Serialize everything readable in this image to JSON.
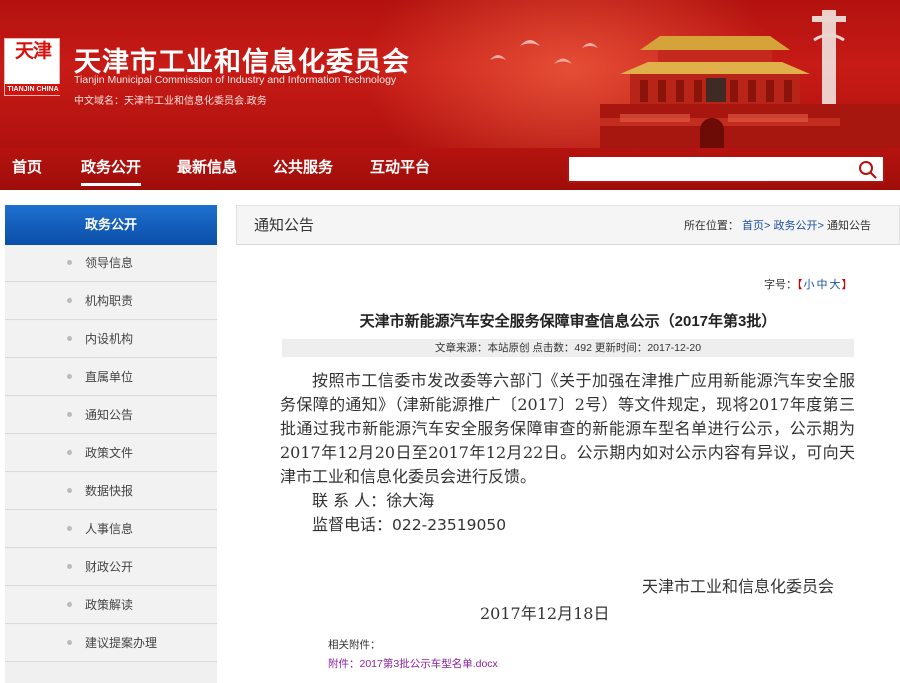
{
  "header": {
    "logo_glyph": "天津",
    "logo_tag": "TIANJIN CHINA",
    "site_title": "天津市工业和信息化委员会",
    "site_subtitle": "Tianjin Municipal Commission  of Industry and Information Technology",
    "domain_line": "中文域名：天津市工业和信息化委员会.政务"
  },
  "nav": {
    "items": [
      {
        "label": "首页"
      },
      {
        "label": "政务公开"
      },
      {
        "label": "最新信息"
      },
      {
        "label": "公共服务"
      },
      {
        "label": "互动平台"
      }
    ],
    "active_index": 1,
    "search": {
      "value": "",
      "placeholder": ""
    }
  },
  "sidebar": {
    "heading": "政务公开",
    "items": [
      {
        "label": "领导信息"
      },
      {
        "label": "机构职责"
      },
      {
        "label": "内设机构"
      },
      {
        "label": "直属单位"
      },
      {
        "label": "通知公告"
      },
      {
        "label": "政策文件"
      },
      {
        "label": "数据快报"
      },
      {
        "label": "人事信息"
      },
      {
        "label": "财政公开"
      },
      {
        "label": "政策解读"
      },
      {
        "label": "建议提案办理"
      }
    ]
  },
  "main": {
    "section_title": "通知公告",
    "breadcrumb": {
      "prefix": "所在位置：",
      "home": "首页>",
      "section": "政务公开>",
      "current": "通知公告"
    },
    "font_size": {
      "label": "字号：",
      "open": "【",
      "small": "小",
      "medium": "中",
      "large": "大",
      "close": "】"
    },
    "article": {
      "title": "天津市新能源汽车安全服务保障审查信息公示（2017年第3批）",
      "meta": "文章来源：本站原创 点击数：492 更新时间：2017-12-20",
      "paragraph": "按照市工信委市发改委等六部门《关于加强在津推广应用新能源汽车安全服务保障的通知》（津新能源推广〔2017〕2号）等文件规定，现将2017年度第三批通过我市新能源汽车安全服务保障审查的新能源车型名单进行公示，公示期为2017年12月20日至2017年12月22日。公示期内如对公示内容有异议，可向天津市工业和信息化委员会进行反馈。",
      "contact_label": "联 系 人：",
      "contact_name": "徐大海",
      "phone_label": "监督电话：",
      "phone_number": "022-23519050",
      "sign_org": "天津市工业和信息化委员会",
      "sign_date": "2017年12月18日",
      "attachments_label": "相关附件：",
      "attachment_link": "附件：2017第3批公示车型名单.docx"
    }
  },
  "colors": {
    "header_red": "#b3120f",
    "sidebar_blue": "#0a4fa8",
    "link_blue": "#1d4fa0",
    "attachment_purple": "#8a1fa0"
  },
  "icons": {
    "search": "search-icon",
    "bullet": "bullet-dot-icon",
    "star": "star-icon"
  }
}
